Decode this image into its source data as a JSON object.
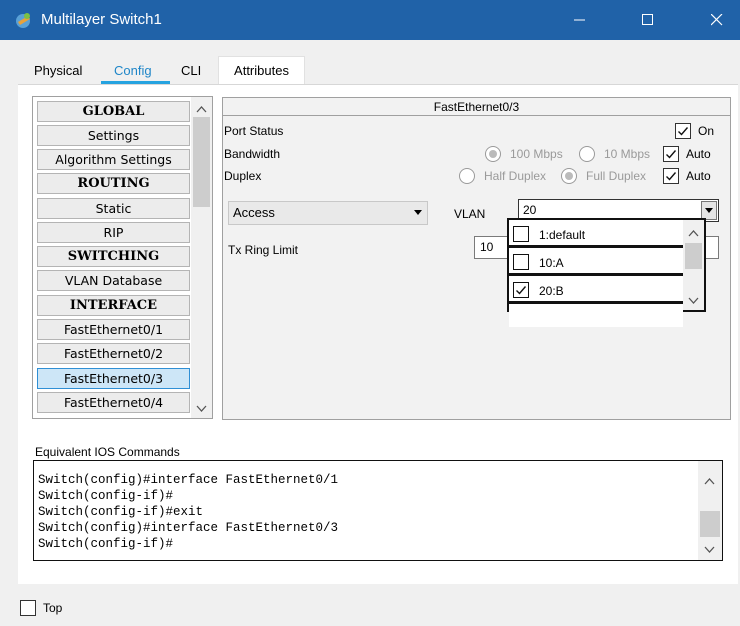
{
  "window": {
    "title": "Multilayer Switch1"
  },
  "tabs": [
    {
      "label": "Physical"
    },
    {
      "label": "Config"
    },
    {
      "label": "CLI"
    },
    {
      "label": "Attributes"
    }
  ],
  "nav": {
    "items": [
      {
        "label": "GLOBAL",
        "header": true
      },
      {
        "label": "Settings"
      },
      {
        "label": "Algorithm Settings"
      },
      {
        "label": "ROUTING",
        "header": true
      },
      {
        "label": "Static"
      },
      {
        "label": "RIP"
      },
      {
        "label": "SWITCHING",
        "header": true
      },
      {
        "label": "VLAN Database"
      },
      {
        "label": "INTERFACE",
        "header": true
      },
      {
        "label": "FastEthernet0/1"
      },
      {
        "label": "FastEthernet0/2"
      },
      {
        "label": "FastEthernet0/3",
        "selected": true
      },
      {
        "label": "FastEthernet0/4"
      }
    ]
  },
  "panel": {
    "title": "FastEthernet0/3",
    "port_status_label": "Port Status",
    "port_status_on_label": "On",
    "bandwidth_label": "Bandwidth",
    "bandwidth_100": "100 Mbps",
    "bandwidth_10": "10 Mbps",
    "bandwidth_auto": "Auto",
    "duplex_label": "Duplex",
    "duplex_half": "Half Duplex",
    "duplex_full": "Full Duplex",
    "duplex_auto": "Auto",
    "mode_value": "Access",
    "vlan_label": "VLAN",
    "vlan_value": "20",
    "tx_ring_label": "Tx Ring Limit",
    "tx_ring_value": "10"
  },
  "vlan_dropdown": {
    "options": [
      {
        "label": "1:default",
        "checked": false
      },
      {
        "label": "10:A",
        "checked": false
      },
      {
        "label": "20:B",
        "checked": true
      }
    ]
  },
  "ios": {
    "label": "Equivalent IOS Commands",
    "lines": [
      "Switch(config)#interface FastEthernet0/1",
      "Switch(config-if)#",
      "Switch(config-if)#exit",
      "Switch(config)#interface FastEthernet0/3",
      "Switch(config-if)#"
    ]
  },
  "footer": {
    "top_label": "Top"
  },
  "colors": {
    "titlebar": "#2062a8",
    "tab_active": "#1f86c8",
    "tab_underline": "#26a3e0",
    "nav_selected": "#cde6f7"
  }
}
